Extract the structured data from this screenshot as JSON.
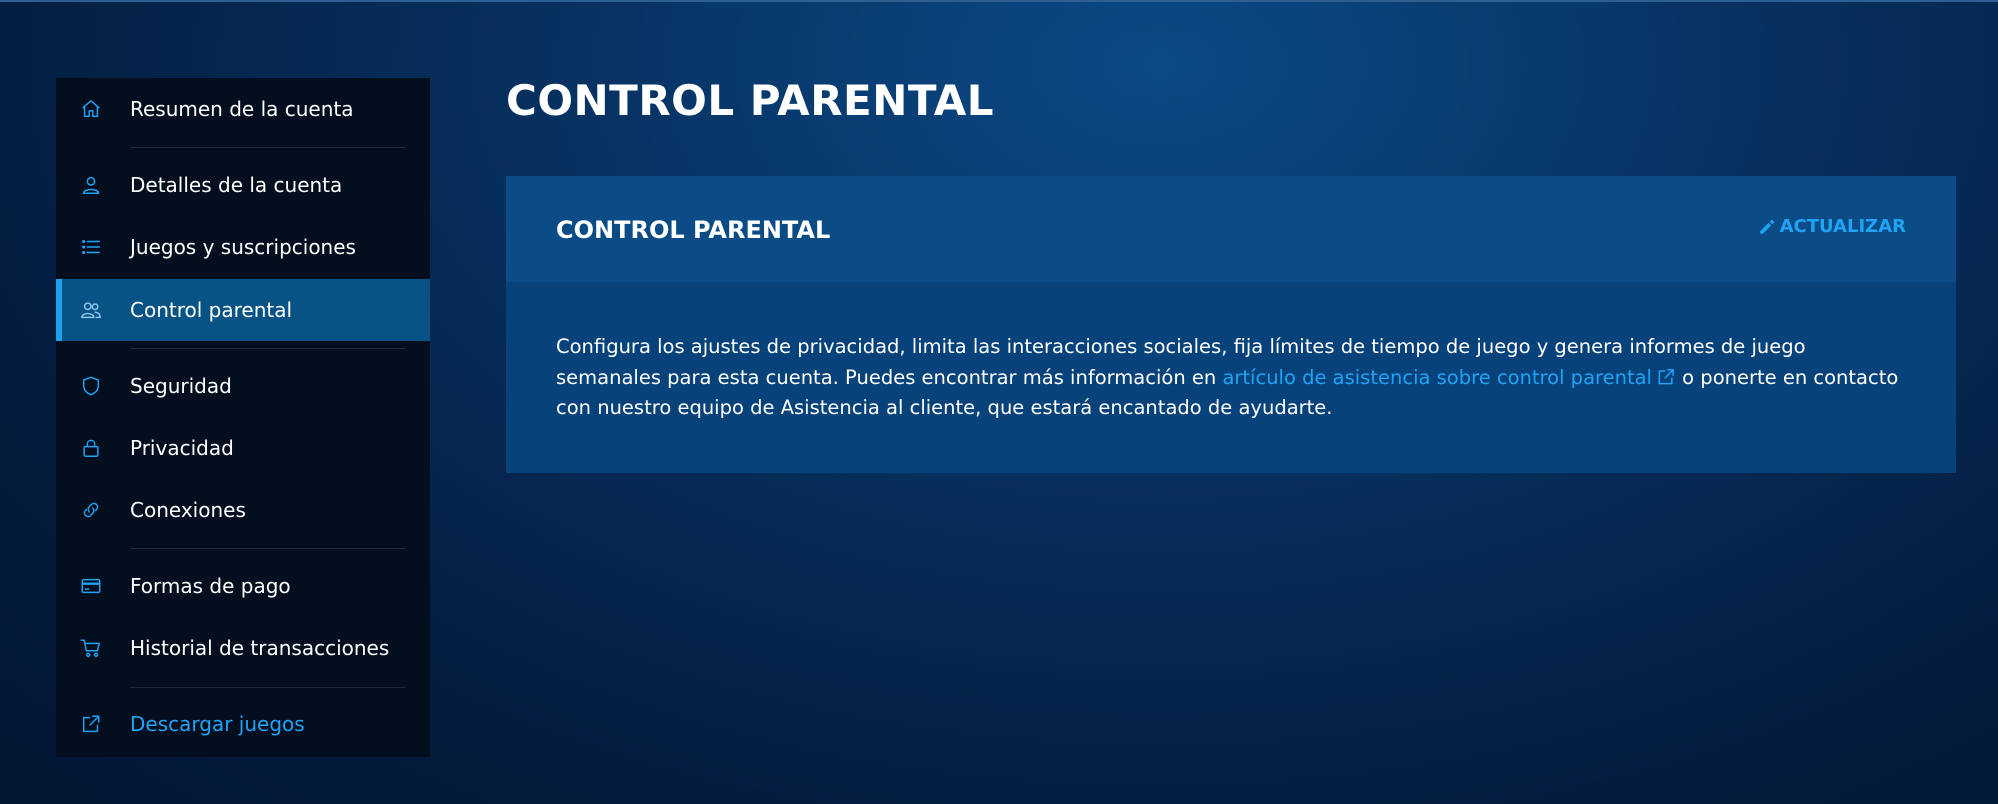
{
  "sidebar": {
    "items": [
      {
        "label": "Resumen de la cuenta",
        "icon": "home-icon"
      },
      {
        "label": "Detalles de la cuenta",
        "icon": "user-icon"
      },
      {
        "label": "Juegos y suscripciones",
        "icon": "list-icon"
      },
      {
        "label": "Control parental",
        "icon": "users-icon",
        "active": true
      },
      {
        "label": "Seguridad",
        "icon": "shield-icon"
      },
      {
        "label": "Privacidad",
        "icon": "lock-icon"
      },
      {
        "label": "Conexiones",
        "icon": "link-icon"
      },
      {
        "label": "Formas de pago",
        "icon": "credit-card-icon"
      },
      {
        "label": "Historial de transacciones",
        "icon": "cart-icon"
      },
      {
        "label": "Descargar juegos",
        "icon": "external-link-icon"
      }
    ]
  },
  "main": {
    "page_title": "CONTROL PARENTAL",
    "card": {
      "title": "CONTROL PARENTAL",
      "update_label": "ACTUALIZAR",
      "body_before_link": "Configura los ajustes de privacidad, limita las interacciones sociales, fija límites de tiempo de juego y genera informes de juego semanales para esta cuenta. Puedes encontrar más información en ",
      "link_text": "artículo de asistencia sobre control parental",
      "body_after_link": " o ponerte en contacto con nuestro equipo de Asistencia al cliente, que estará encantado de ayudarte."
    }
  },
  "colors": {
    "accent": "#1ea3f5",
    "active_item_bg": "#075385",
    "sidebar_bg": "#030f1f",
    "card_bg": "#08427a"
  }
}
